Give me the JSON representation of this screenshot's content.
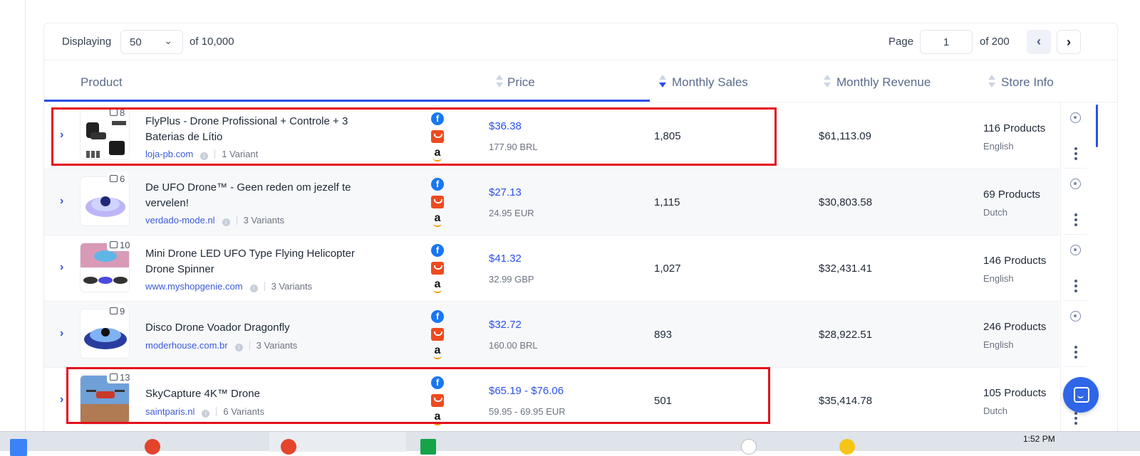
{
  "toolbar": {
    "displaying_label": "Displaying",
    "per_page": "50",
    "total_label": "of 10,000",
    "page_label": "Page",
    "page_value": "1",
    "page_total": "of 200"
  },
  "columns": {
    "product": "Product",
    "price": "Price",
    "monthly_sales": "Monthly Sales",
    "monthly_revenue": "Monthly Revenue",
    "store_info": "Store Info"
  },
  "rows": [
    {
      "image_count": "8",
      "title": "FlyPlus - Drone Profissional + Controle + 3 Baterias de Lítio",
      "store": "loja-pb.com",
      "variants": "1 Variant",
      "price": "$36.38",
      "local_price": "177.90 BRL",
      "monthly_sales": "1,805",
      "monthly_revenue": "$61,113.09",
      "store_products": "116 Products",
      "store_language": "English"
    },
    {
      "image_count": "6",
      "title": "De UFO Drone™ - Geen reden om jezelf te vervelen!",
      "store": "verdado-mode.nl",
      "variants": "3 Variants",
      "price": "$27.13",
      "local_price": "24.95 EUR",
      "monthly_sales": "1,115",
      "monthly_revenue": "$30,803.58",
      "store_products": "69 Products",
      "store_language": "Dutch"
    },
    {
      "image_count": "10",
      "title": "Mini Drone LED UFO Type Flying Helicopter Drone Spinner",
      "store": "www.myshopgenie.com",
      "variants": "3 Variants",
      "price": "$41.32",
      "local_price": "32.99 GBP",
      "monthly_sales": "1,027",
      "monthly_revenue": "$32,431.41",
      "store_products": "146 Products",
      "store_language": "English"
    },
    {
      "image_count": "9",
      "title": "Disco Drone Voador Dragonfly",
      "store": "moderhouse.com.br",
      "variants": "3 Variants",
      "price": "$32.72",
      "local_price": "160.00 BRL",
      "monthly_sales": "893",
      "monthly_revenue": "$28,922.51",
      "store_products": "246 Products",
      "store_language": "English"
    },
    {
      "image_count": "13",
      "title": "SkyCapture 4K™ Drone",
      "store": "saintparis.nl",
      "variants": "6 Variants",
      "price": "$65.19 - $76.06",
      "local_price": "59.95 - 69.95 EUR",
      "monthly_sales": "501",
      "monthly_revenue": "$35,414.78",
      "store_products": "105 Products",
      "store_language": "Dutch"
    }
  ],
  "source_icons": {
    "facebook": "f",
    "amazon": "a"
  },
  "taskbar": {
    "clock": "1:52 PM"
  },
  "colors": {
    "accent": "#2b50e6",
    "highlight": "#e3101a",
    "facebook": "#1877f2",
    "aliexpress": "#ef4a1f"
  }
}
